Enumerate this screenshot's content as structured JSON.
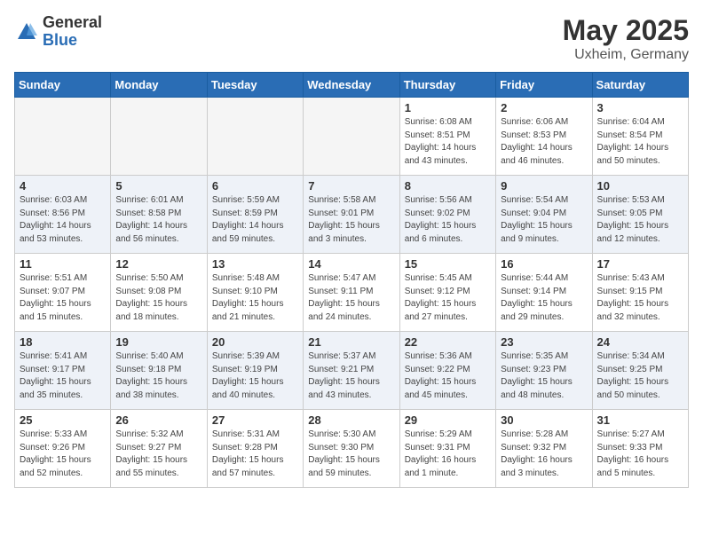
{
  "header": {
    "logo_general": "General",
    "logo_blue": "Blue",
    "title": "May 2025",
    "subtitle": "Uxheim, Germany"
  },
  "weekdays": [
    "Sunday",
    "Monday",
    "Tuesday",
    "Wednesday",
    "Thursday",
    "Friday",
    "Saturday"
  ],
  "weeks": [
    [
      {
        "day": "",
        "info": "",
        "empty": true
      },
      {
        "day": "",
        "info": "",
        "empty": true
      },
      {
        "day": "",
        "info": "",
        "empty": true
      },
      {
        "day": "",
        "info": "",
        "empty": true
      },
      {
        "day": "1",
        "info": "Sunrise: 6:08 AM\nSunset: 8:51 PM\nDaylight: 14 hours\nand 43 minutes.",
        "empty": false
      },
      {
        "day": "2",
        "info": "Sunrise: 6:06 AM\nSunset: 8:53 PM\nDaylight: 14 hours\nand 46 minutes.",
        "empty": false
      },
      {
        "day": "3",
        "info": "Sunrise: 6:04 AM\nSunset: 8:54 PM\nDaylight: 14 hours\nand 50 minutes.",
        "empty": false
      }
    ],
    [
      {
        "day": "4",
        "info": "Sunrise: 6:03 AM\nSunset: 8:56 PM\nDaylight: 14 hours\nand 53 minutes.",
        "empty": false
      },
      {
        "day": "5",
        "info": "Sunrise: 6:01 AM\nSunset: 8:58 PM\nDaylight: 14 hours\nand 56 minutes.",
        "empty": false
      },
      {
        "day": "6",
        "info": "Sunrise: 5:59 AM\nSunset: 8:59 PM\nDaylight: 14 hours\nand 59 minutes.",
        "empty": false
      },
      {
        "day": "7",
        "info": "Sunrise: 5:58 AM\nSunset: 9:01 PM\nDaylight: 15 hours\nand 3 minutes.",
        "empty": false
      },
      {
        "day": "8",
        "info": "Sunrise: 5:56 AM\nSunset: 9:02 PM\nDaylight: 15 hours\nand 6 minutes.",
        "empty": false
      },
      {
        "day": "9",
        "info": "Sunrise: 5:54 AM\nSunset: 9:04 PM\nDaylight: 15 hours\nand 9 minutes.",
        "empty": false
      },
      {
        "day": "10",
        "info": "Sunrise: 5:53 AM\nSunset: 9:05 PM\nDaylight: 15 hours\nand 12 minutes.",
        "empty": false
      }
    ],
    [
      {
        "day": "11",
        "info": "Sunrise: 5:51 AM\nSunset: 9:07 PM\nDaylight: 15 hours\nand 15 minutes.",
        "empty": false
      },
      {
        "day": "12",
        "info": "Sunrise: 5:50 AM\nSunset: 9:08 PM\nDaylight: 15 hours\nand 18 minutes.",
        "empty": false
      },
      {
        "day": "13",
        "info": "Sunrise: 5:48 AM\nSunset: 9:10 PM\nDaylight: 15 hours\nand 21 minutes.",
        "empty": false
      },
      {
        "day": "14",
        "info": "Sunrise: 5:47 AM\nSunset: 9:11 PM\nDaylight: 15 hours\nand 24 minutes.",
        "empty": false
      },
      {
        "day": "15",
        "info": "Sunrise: 5:45 AM\nSunset: 9:12 PM\nDaylight: 15 hours\nand 27 minutes.",
        "empty": false
      },
      {
        "day": "16",
        "info": "Sunrise: 5:44 AM\nSunset: 9:14 PM\nDaylight: 15 hours\nand 29 minutes.",
        "empty": false
      },
      {
        "day": "17",
        "info": "Sunrise: 5:43 AM\nSunset: 9:15 PM\nDaylight: 15 hours\nand 32 minutes.",
        "empty": false
      }
    ],
    [
      {
        "day": "18",
        "info": "Sunrise: 5:41 AM\nSunset: 9:17 PM\nDaylight: 15 hours\nand 35 minutes.",
        "empty": false
      },
      {
        "day": "19",
        "info": "Sunrise: 5:40 AM\nSunset: 9:18 PM\nDaylight: 15 hours\nand 38 minutes.",
        "empty": false
      },
      {
        "day": "20",
        "info": "Sunrise: 5:39 AM\nSunset: 9:19 PM\nDaylight: 15 hours\nand 40 minutes.",
        "empty": false
      },
      {
        "day": "21",
        "info": "Sunrise: 5:37 AM\nSunset: 9:21 PM\nDaylight: 15 hours\nand 43 minutes.",
        "empty": false
      },
      {
        "day": "22",
        "info": "Sunrise: 5:36 AM\nSunset: 9:22 PM\nDaylight: 15 hours\nand 45 minutes.",
        "empty": false
      },
      {
        "day": "23",
        "info": "Sunrise: 5:35 AM\nSunset: 9:23 PM\nDaylight: 15 hours\nand 48 minutes.",
        "empty": false
      },
      {
        "day": "24",
        "info": "Sunrise: 5:34 AM\nSunset: 9:25 PM\nDaylight: 15 hours\nand 50 minutes.",
        "empty": false
      }
    ],
    [
      {
        "day": "25",
        "info": "Sunrise: 5:33 AM\nSunset: 9:26 PM\nDaylight: 15 hours\nand 52 minutes.",
        "empty": false
      },
      {
        "day": "26",
        "info": "Sunrise: 5:32 AM\nSunset: 9:27 PM\nDaylight: 15 hours\nand 55 minutes.",
        "empty": false
      },
      {
        "day": "27",
        "info": "Sunrise: 5:31 AM\nSunset: 9:28 PM\nDaylight: 15 hours\nand 57 minutes.",
        "empty": false
      },
      {
        "day": "28",
        "info": "Sunrise: 5:30 AM\nSunset: 9:30 PM\nDaylight: 15 hours\nand 59 minutes.",
        "empty": false
      },
      {
        "day": "29",
        "info": "Sunrise: 5:29 AM\nSunset: 9:31 PM\nDaylight: 16 hours\nand 1 minute.",
        "empty": false
      },
      {
        "day": "30",
        "info": "Sunrise: 5:28 AM\nSunset: 9:32 PM\nDaylight: 16 hours\nand 3 minutes.",
        "empty": false
      },
      {
        "day": "31",
        "info": "Sunrise: 5:27 AM\nSunset: 9:33 PM\nDaylight: 16 hours\nand 5 minutes.",
        "empty": false
      }
    ]
  ]
}
